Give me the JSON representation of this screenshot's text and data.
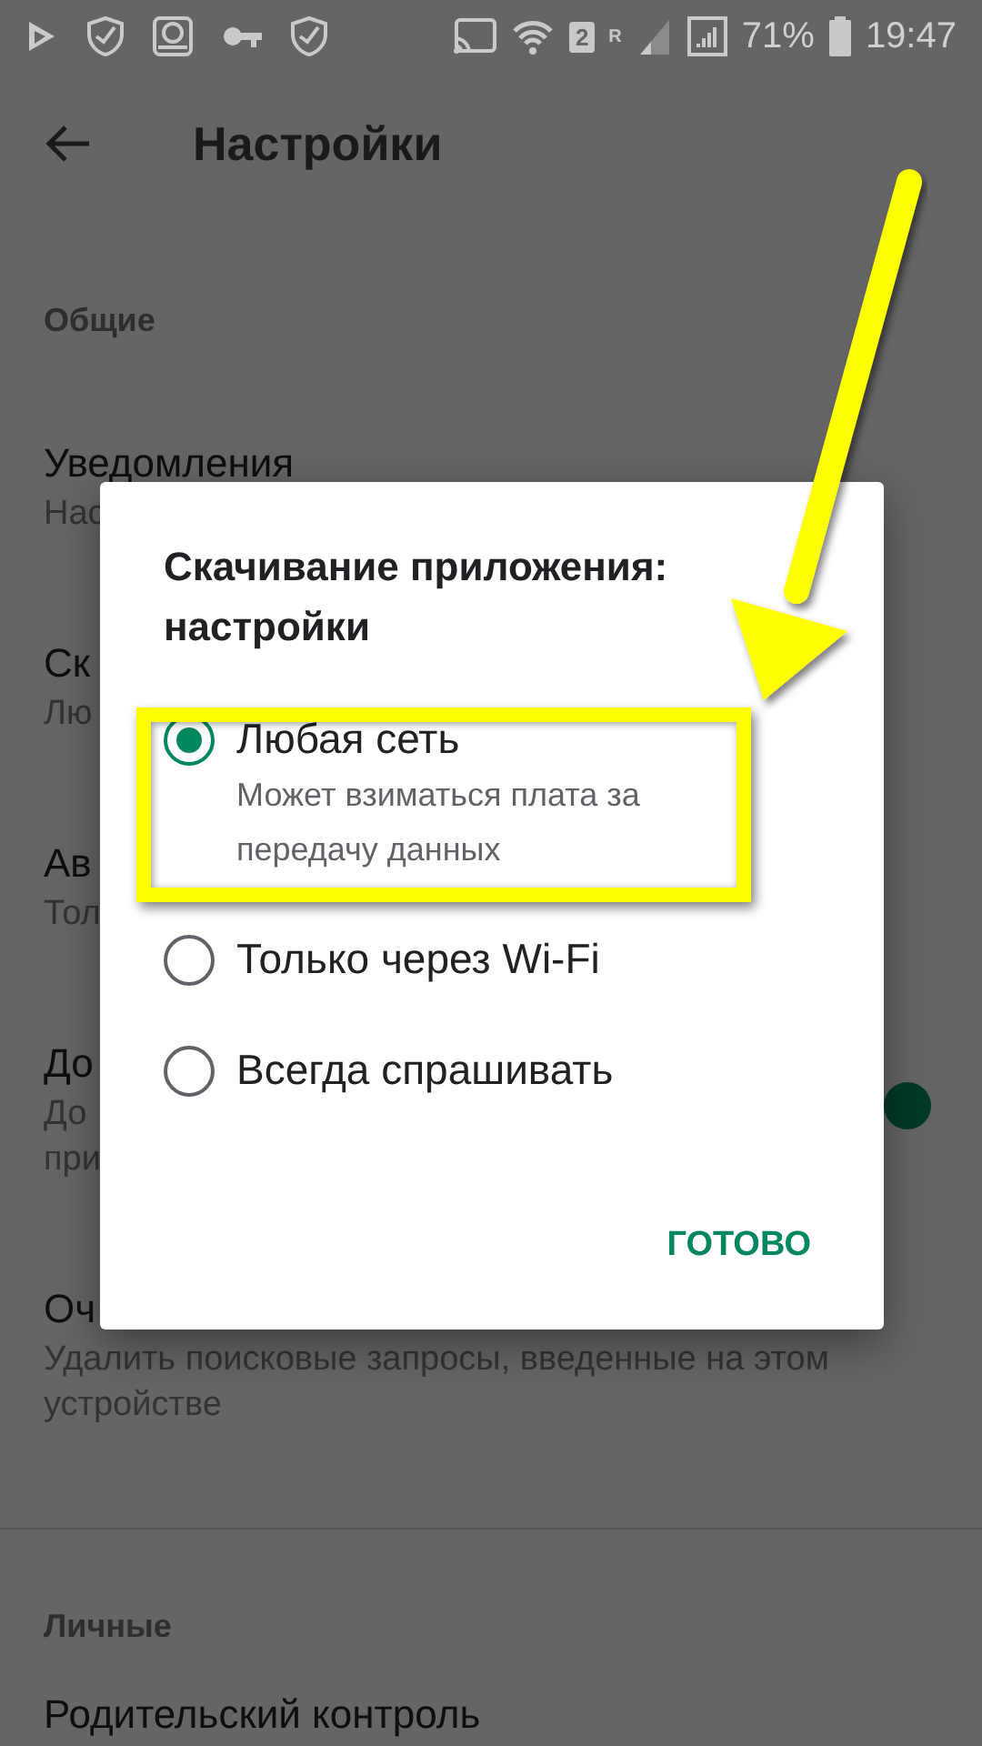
{
  "status_bar": {
    "sim_badge": "2",
    "roaming": "R",
    "battery": "71%",
    "time": "19:47"
  },
  "app_bar": {
    "title": "Настройки"
  },
  "sections": [
    {
      "header": "Общие",
      "items": [
        {
          "title": "Уведомления",
          "subtitle_lines": [
            "Нас"
          ]
        },
        {
          "title": "Ск",
          "subtitle_lines": [
            "Лю"
          ]
        },
        {
          "title": "Ав",
          "subtitle_lines": [
            "Тол"
          ]
        },
        {
          "title": "До",
          "subtitle_lines": [
            "До",
            "при"
          ],
          "toggle": {
            "on": true
          }
        },
        {
          "title": "Оч",
          "subtitle_lines": [
            "Удалить поисковые запросы, введенные на этом устройстве"
          ]
        }
      ]
    },
    {
      "header": "Личные",
      "items": [
        {
          "title": "Родительский контроль"
        }
      ]
    }
  ],
  "dialog": {
    "title": "Скачивание приложения: настройки",
    "options": [
      {
        "label": "Любая сеть",
        "subtitle": "Может взиматься плата за передачу данных",
        "selected": true
      },
      {
        "label": "Только через Wi-Fi",
        "selected": false
      },
      {
        "label": "Всегда спрашивать",
        "selected": false
      }
    ],
    "button": "ГОТОВО"
  }
}
